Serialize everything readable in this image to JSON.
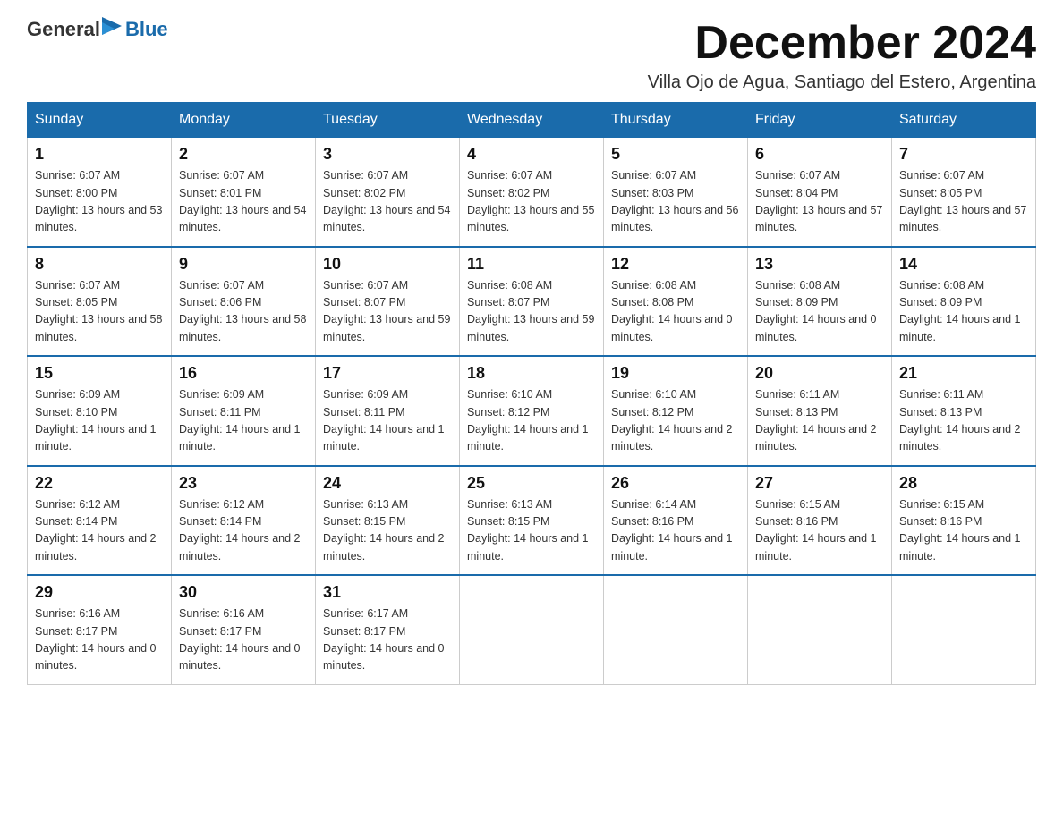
{
  "logo": {
    "general": "General",
    "blue": "Blue"
  },
  "title": "December 2024",
  "subtitle": "Villa Ojo de Agua, Santiago del Estero, Argentina",
  "days_of_week": [
    "Sunday",
    "Monday",
    "Tuesday",
    "Wednesday",
    "Thursday",
    "Friday",
    "Saturday"
  ],
  "weeks": [
    [
      {
        "day": "1",
        "sunrise": "6:07 AM",
        "sunset": "8:00 PM",
        "daylight": "13 hours and 53 minutes."
      },
      {
        "day": "2",
        "sunrise": "6:07 AM",
        "sunset": "8:01 PM",
        "daylight": "13 hours and 54 minutes."
      },
      {
        "day": "3",
        "sunrise": "6:07 AM",
        "sunset": "8:02 PM",
        "daylight": "13 hours and 54 minutes."
      },
      {
        "day": "4",
        "sunrise": "6:07 AM",
        "sunset": "8:02 PM",
        "daylight": "13 hours and 55 minutes."
      },
      {
        "day": "5",
        "sunrise": "6:07 AM",
        "sunset": "8:03 PM",
        "daylight": "13 hours and 56 minutes."
      },
      {
        "day": "6",
        "sunrise": "6:07 AM",
        "sunset": "8:04 PM",
        "daylight": "13 hours and 57 minutes."
      },
      {
        "day": "7",
        "sunrise": "6:07 AM",
        "sunset": "8:05 PM",
        "daylight": "13 hours and 57 minutes."
      }
    ],
    [
      {
        "day": "8",
        "sunrise": "6:07 AM",
        "sunset": "8:05 PM",
        "daylight": "13 hours and 58 minutes."
      },
      {
        "day": "9",
        "sunrise": "6:07 AM",
        "sunset": "8:06 PM",
        "daylight": "13 hours and 58 minutes."
      },
      {
        "day": "10",
        "sunrise": "6:07 AM",
        "sunset": "8:07 PM",
        "daylight": "13 hours and 59 minutes."
      },
      {
        "day": "11",
        "sunrise": "6:08 AM",
        "sunset": "8:07 PM",
        "daylight": "13 hours and 59 minutes."
      },
      {
        "day": "12",
        "sunrise": "6:08 AM",
        "sunset": "8:08 PM",
        "daylight": "14 hours and 0 minutes."
      },
      {
        "day": "13",
        "sunrise": "6:08 AM",
        "sunset": "8:09 PM",
        "daylight": "14 hours and 0 minutes."
      },
      {
        "day": "14",
        "sunrise": "6:08 AM",
        "sunset": "8:09 PM",
        "daylight": "14 hours and 1 minute."
      }
    ],
    [
      {
        "day": "15",
        "sunrise": "6:09 AM",
        "sunset": "8:10 PM",
        "daylight": "14 hours and 1 minute."
      },
      {
        "day": "16",
        "sunrise": "6:09 AM",
        "sunset": "8:11 PM",
        "daylight": "14 hours and 1 minute."
      },
      {
        "day": "17",
        "sunrise": "6:09 AM",
        "sunset": "8:11 PM",
        "daylight": "14 hours and 1 minute."
      },
      {
        "day": "18",
        "sunrise": "6:10 AM",
        "sunset": "8:12 PM",
        "daylight": "14 hours and 1 minute."
      },
      {
        "day": "19",
        "sunrise": "6:10 AM",
        "sunset": "8:12 PM",
        "daylight": "14 hours and 2 minutes."
      },
      {
        "day": "20",
        "sunrise": "6:11 AM",
        "sunset": "8:13 PM",
        "daylight": "14 hours and 2 minutes."
      },
      {
        "day": "21",
        "sunrise": "6:11 AM",
        "sunset": "8:13 PM",
        "daylight": "14 hours and 2 minutes."
      }
    ],
    [
      {
        "day": "22",
        "sunrise": "6:12 AM",
        "sunset": "8:14 PM",
        "daylight": "14 hours and 2 minutes."
      },
      {
        "day": "23",
        "sunrise": "6:12 AM",
        "sunset": "8:14 PM",
        "daylight": "14 hours and 2 minutes."
      },
      {
        "day": "24",
        "sunrise": "6:13 AM",
        "sunset": "8:15 PM",
        "daylight": "14 hours and 2 minutes."
      },
      {
        "day": "25",
        "sunrise": "6:13 AM",
        "sunset": "8:15 PM",
        "daylight": "14 hours and 1 minute."
      },
      {
        "day": "26",
        "sunrise": "6:14 AM",
        "sunset": "8:16 PM",
        "daylight": "14 hours and 1 minute."
      },
      {
        "day": "27",
        "sunrise": "6:15 AM",
        "sunset": "8:16 PM",
        "daylight": "14 hours and 1 minute."
      },
      {
        "day": "28",
        "sunrise": "6:15 AM",
        "sunset": "8:16 PM",
        "daylight": "14 hours and 1 minute."
      }
    ],
    [
      {
        "day": "29",
        "sunrise": "6:16 AM",
        "sunset": "8:17 PM",
        "daylight": "14 hours and 0 minutes."
      },
      {
        "day": "30",
        "sunrise": "6:16 AM",
        "sunset": "8:17 PM",
        "daylight": "14 hours and 0 minutes."
      },
      {
        "day": "31",
        "sunrise": "6:17 AM",
        "sunset": "8:17 PM",
        "daylight": "14 hours and 0 minutes."
      },
      null,
      null,
      null,
      null
    ]
  ]
}
